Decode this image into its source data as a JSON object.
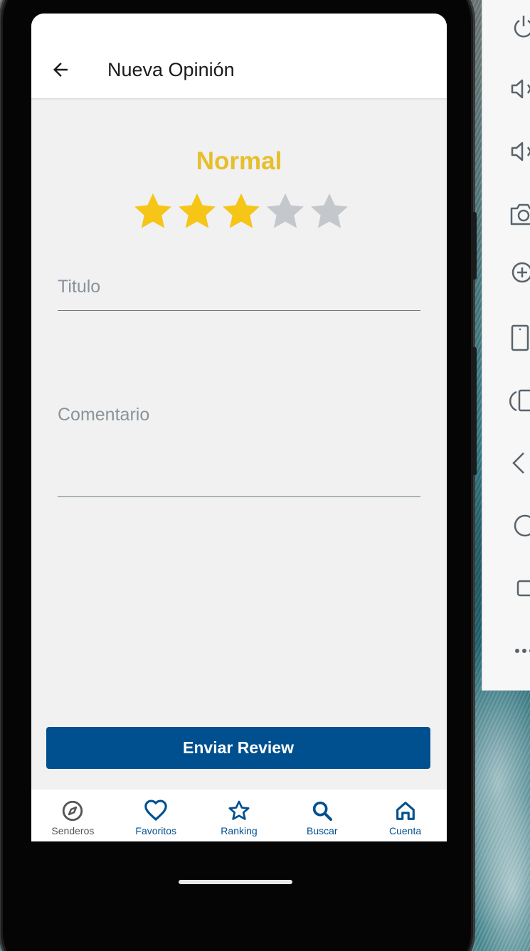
{
  "app": {
    "title": "Nueva Opinión"
  },
  "rating": {
    "label": "Normal",
    "value": 3,
    "max": 5,
    "filled_color": "#f5c518",
    "empty_color": "#c4c8cc"
  },
  "form": {
    "title_placeholder": "Titulo",
    "comment_placeholder": "Comentario",
    "submit_label": "Enviar Review"
  },
  "bottom_nav": {
    "items": [
      {
        "label": "Senderos",
        "icon": "compass-icon",
        "color": "#555555"
      },
      {
        "label": "Favoritos",
        "icon": "heart-icon",
        "color": "#00508f"
      },
      {
        "label": "Ranking",
        "icon": "star-icon",
        "color": "#00508f"
      },
      {
        "label": "Buscar",
        "icon": "search-icon",
        "color": "#00508f"
      },
      {
        "label": "Cuenta",
        "icon": "home-icon",
        "color": "#00508f"
      }
    ]
  },
  "colors": {
    "primary": "#00508f",
    "accent": "#e7be2b"
  },
  "emulator_toolbar": {
    "icons": [
      "power-icon",
      "volume-up-icon",
      "volume-down-icon",
      "camera-icon",
      "zoom-in-icon",
      "rotate-portrait-icon",
      "rotate-icon",
      "back-icon",
      "home-circle-icon",
      "overview-icon",
      "more-icon"
    ]
  }
}
